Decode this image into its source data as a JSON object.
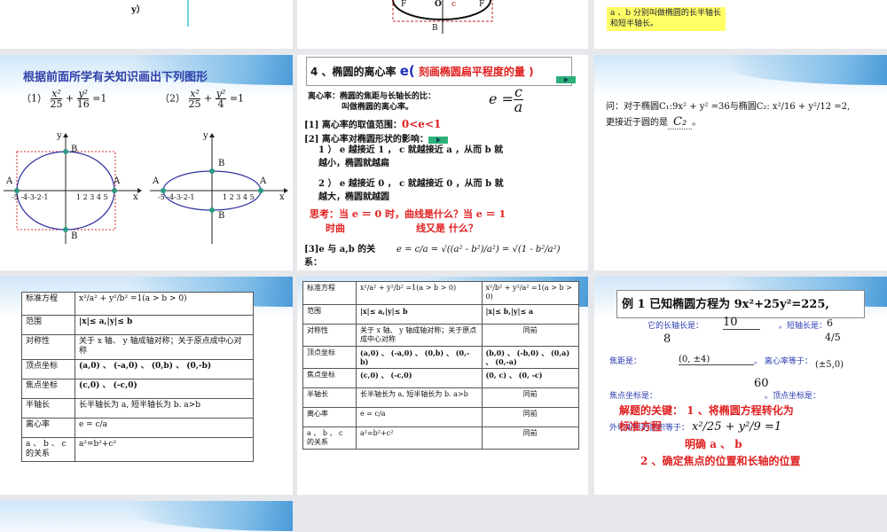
{
  "slides": [
    {
      "id": "s1",
      "text": "y）"
    },
    {
      "id": "s2",
      "labels": {
        "f1": "F",
        "o": "O",
        "c": "c",
        "f2": "F",
        "b1": "B"
      }
    },
    {
      "id": "s3",
      "note": "a 、b 分别叫做椭圆的长半轴长和短半轴长。"
    },
    {
      "id": "s4",
      "title": "根据前面所学有关知识画出下列图形",
      "eq1_label": "（1）",
      "eq1": {
        "n1": "x²",
        "d1": "25",
        "n2": "y²",
        "d2": "16",
        "rhs": "=1"
      },
      "eq2_label": "（2）",
      "eq2": {
        "n1": "x²",
        "d1": "25",
        "n2": "y²",
        "d2": "4",
        "rhs": "=1"
      },
      "axis_x": "x",
      "axis_y": "y",
      "xticks": "-5 -4-3-2-1",
      "xticks_pos": "1 2 3 4 5",
      "points": {
        "a1": "A",
        "a2": "A",
        "b1": "B",
        "b2": "B"
      }
    },
    {
      "id": "s5",
      "heading_prefix": "4 、椭圆的离心率 ",
      "heading_e": "e(",
      "heading_red": " 刻画椭圆扁平程度的量 )",
      "def": "离心率：椭圆的焦距与长轴长的比：",
      "def2": "叫做椭圆的离心率。",
      "formula": "e =",
      "fc": "c",
      "fa": "a",
      "r1_label": "[1] 离心率的取值范围：",
      "r1_value": "0<e<1",
      "r2_label": "[2] 离心率对椭圆形状的影响：",
      "p1a": "1 ） e 越接近  1 ， c 就越接近  a ，从而  b 就",
      "p1b": "越小，椭圆就越扁",
      "p2a": "2 ） e 越接近  0 ， c 就越接近  0 ，从而  b 就",
      "p2b": "越大，椭圆就越圆",
      "think1": "思考：当 e ＝ 0 时，曲线是什么？当 e ＝ 1",
      "think2": "时曲",
      "think3": "线又是 什么？",
      "r3a": "[3]e 与 a,b 的关",
      "r3b": "系：",
      "r3_formula": "e = c/a = √((a² - b²)/a²) = √(1 - b²/a²)"
    },
    {
      "id": "s6",
      "q1": "问：对于椭圆C₁:9x² + y² =36与椭圆C₂: x²/16 + y²/12 =2,",
      "q2": "更接近于圆的是",
      "answer": "C₂",
      "q_end": "。"
    },
    {
      "id": "s7",
      "rows": [
        [
          "标准方程",
          "x²/a² + y²/b² =1(a > b > 0)"
        ],
        [
          "范围",
          "|x|≤ a,|y|≤ b"
        ],
        [
          "对称性",
          "关于 x 轴、 y 轴成轴对称；关于原点成中心对称"
        ],
        [
          "顶点坐标",
          "(a,0) 、 (-a,0) 、 (0,b) 、 (0,-b)"
        ],
        [
          "焦点坐标",
          "(c,0) 、 (-c,0)"
        ],
        [
          "半轴长",
          "长半轴长为 a, 短半轴长为 b.   a>b"
        ],
        [
          "离心率",
          "e = c/a"
        ],
        [
          "a 、 b 、 c 的关系",
          "a²=b²+c²"
        ]
      ]
    },
    {
      "id": "s8",
      "rows": [
        [
          "标准方程",
          "x²/a² + y²/b² =1(a > b > 0)",
          "x²/b² + y²/a² =1(a > b > 0)"
        ],
        [
          "范围",
          "|x|≤ a,|y|≤ b",
          "|x|≤ b,|y|≤ a"
        ],
        [
          "对称性",
          "关于 x 轴、 y 轴成轴对称；关于原点成中心对称",
          "同前"
        ],
        [
          "顶点坐标",
          "(a,0) 、 (-a,0) 、 (0,b) 、 (0,-b)",
          "(b,0) 、 (-b,0) 、 (0,a) 、 (0,-a)"
        ],
        [
          "焦点坐标",
          "(c,0) 、 (-c,0)",
          "(0, c) 、 (0, -c)"
        ],
        [
          "半轴长",
          "长半轴长为 a, 短半轴长为 b.  a>b",
          "同前"
        ],
        [
          "离心率",
          "e = c/a",
          "同前"
        ],
        [
          "a 、 b 、 c 的关系",
          "a²=b²+c²",
          "同前"
        ]
      ]
    },
    {
      "id": "s9",
      "title": "例 1 已知椭圆方程为 9x²+25y²=225,",
      "l1": "它的长轴长是：",
      "v1": "10",
      "l1b": "。短轴长是：",
      "v2": "8",
      "l2": "焦距是：",
      "v3": "(0, ±4)",
      "l2b": "。    离心率等于：",
      "v4": "4/5",
      "v4b": "6",
      "v5": "(±5,0)",
      "l3": "焦点坐标是：",
      "v6": "60",
      "l3b": "。顶点坐标是：",
      "l4": "外切矩形的面积等于：",
      "key1": "解题的关键：  1 、将椭圆方程转化为",
      "key1b": "标准方程",
      "key_eq": "x²/25 + y²/9 =1",
      "key2": "明确 a 、 b",
      "key3": "2 、确定焦点的位置和长轴的位置"
    },
    {
      "id": "s10"
    }
  ],
  "colors": {
    "bg": "#e6e8ec",
    "blue_text": "#2a3cb0",
    "red": "#e02020",
    "green": "#2bb07a",
    "ellipse": "#3030a0"
  }
}
